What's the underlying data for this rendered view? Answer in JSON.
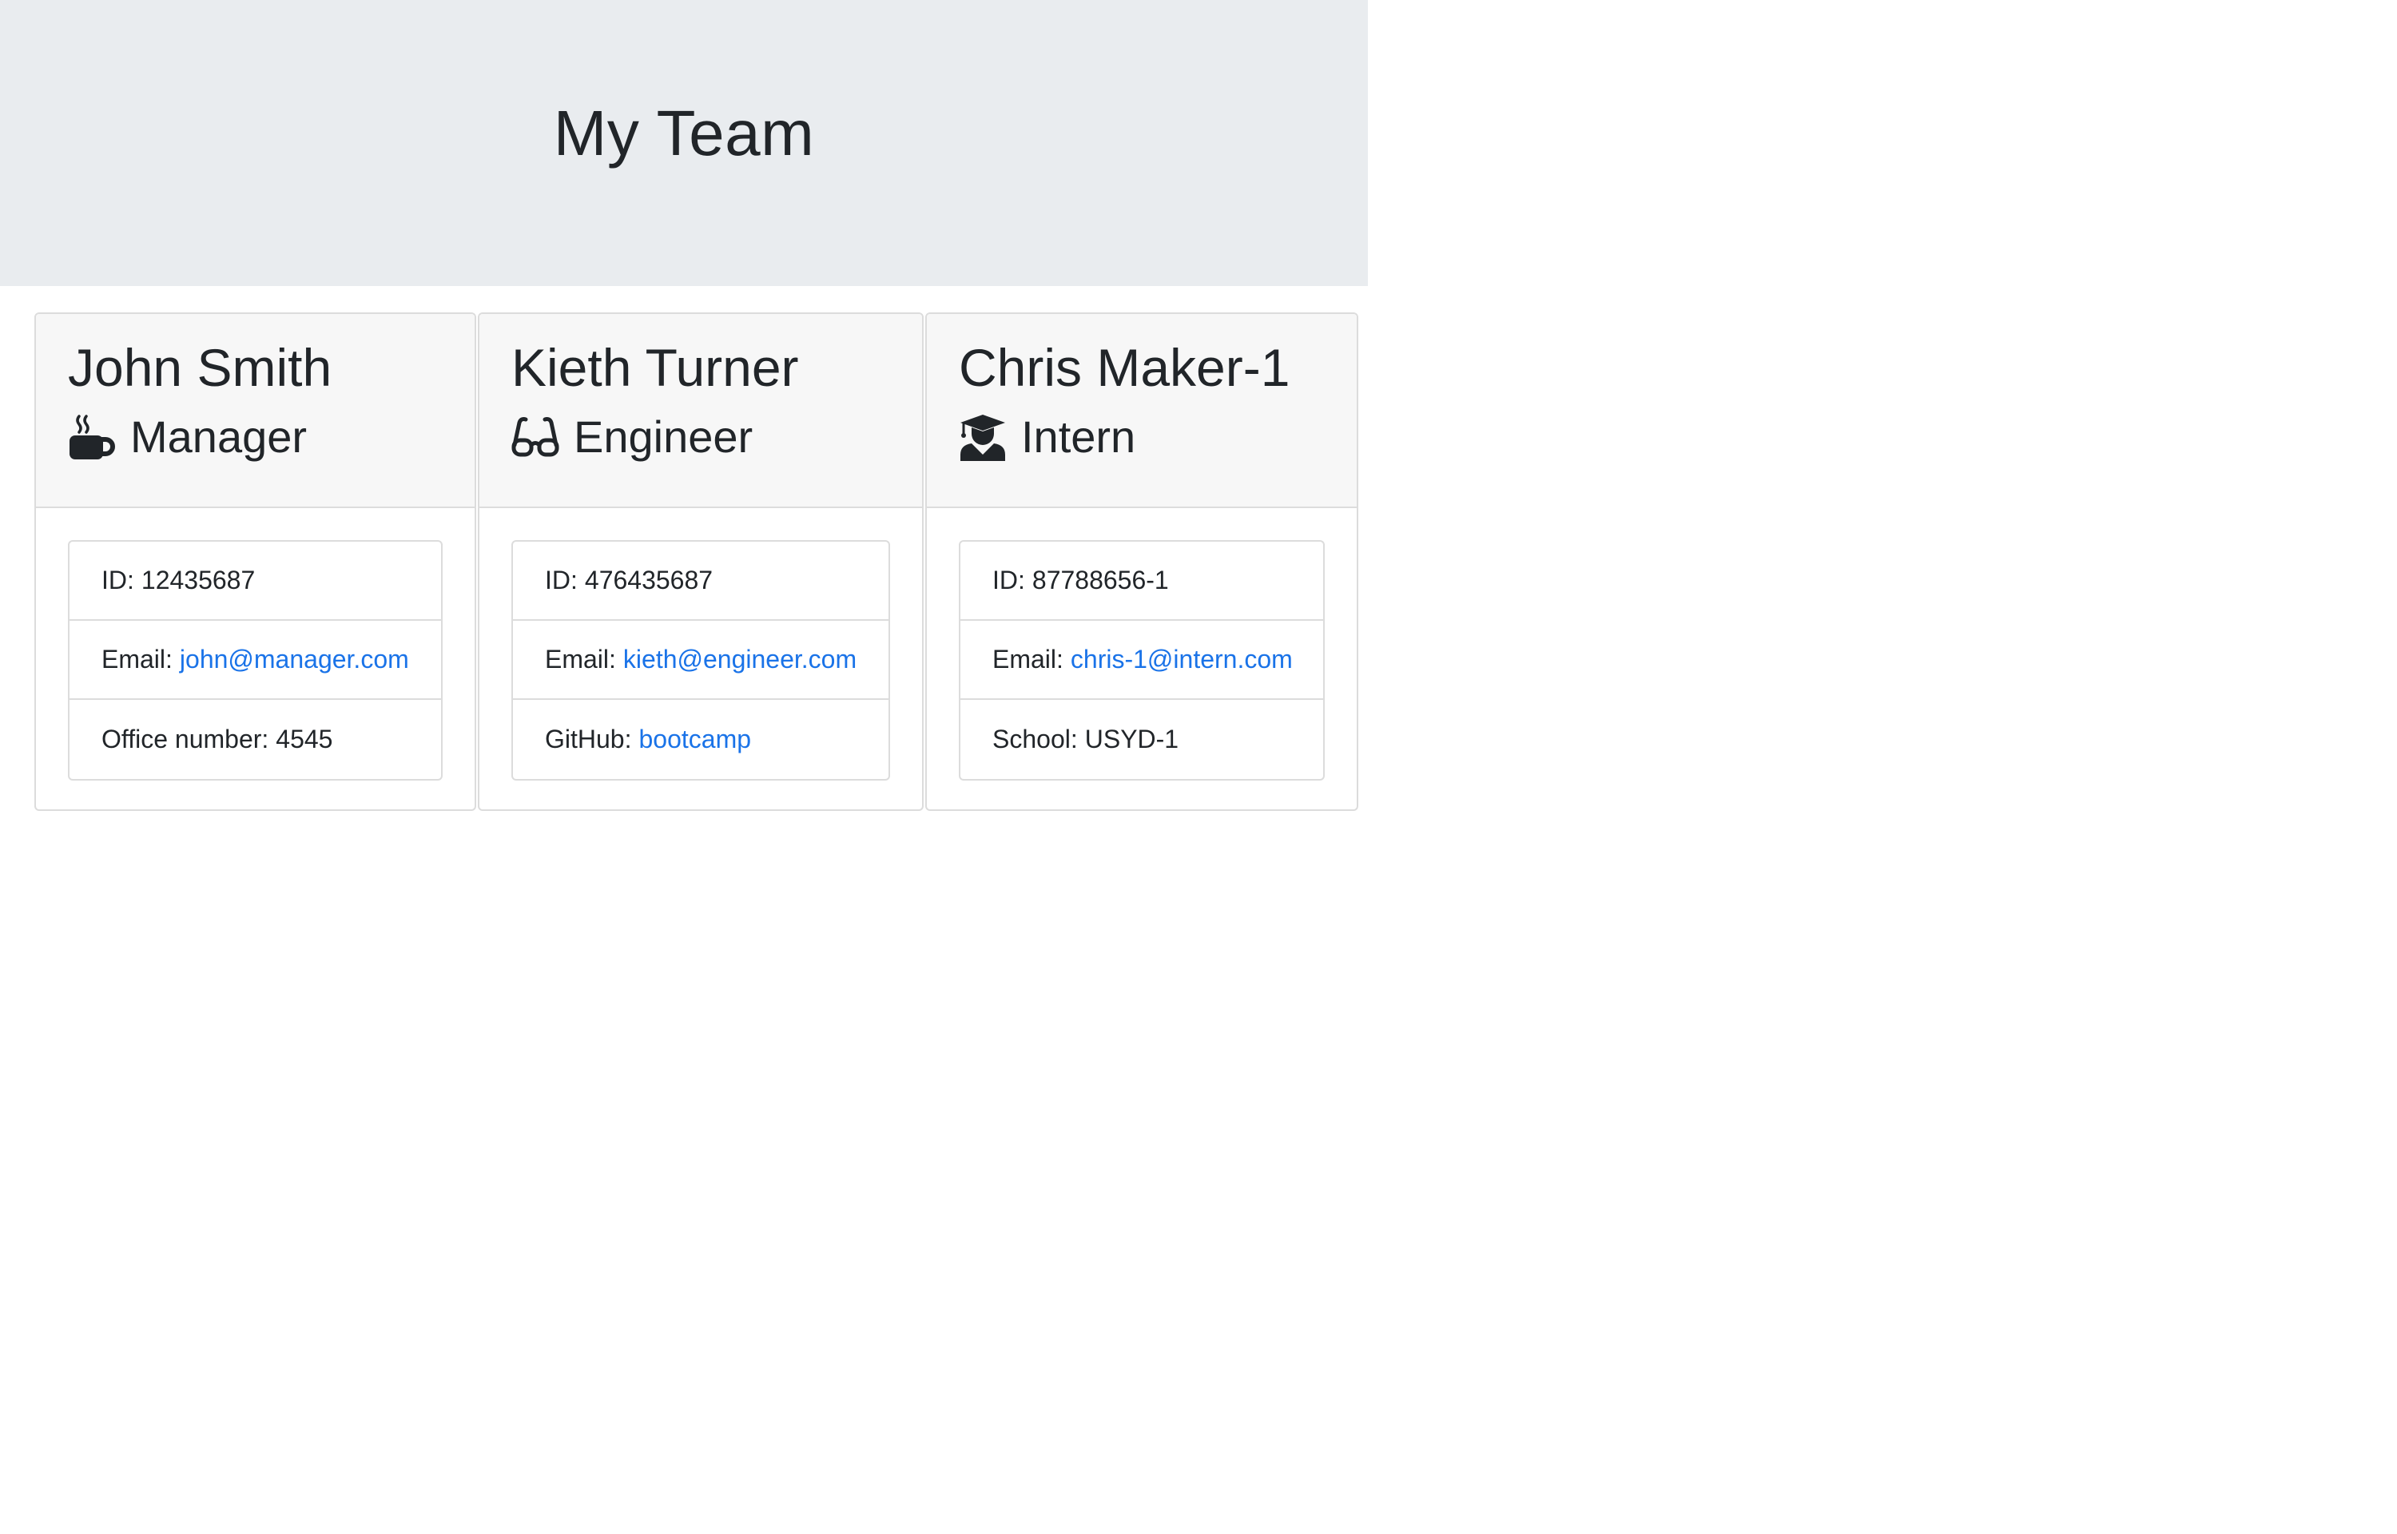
{
  "header": {
    "title": "My Team"
  },
  "members": [
    {
      "name": "John Smith",
      "role": "Manager",
      "icon": "mug-hot-icon",
      "id_label": "ID:",
      "id": "12435687",
      "email_label": "Email:",
      "email": "john@manager.com",
      "extra_label": "Office number:",
      "extra_value": "4545"
    },
    {
      "name": "Kieth Turner",
      "role": "Engineer",
      "icon": "glasses-icon",
      "id_label": "ID:",
      "id": "476435687",
      "email_label": "Email:",
      "email": "kieth@engineer.com",
      "extra_label": "GitHub:",
      "extra_value": "bootcamp"
    },
    {
      "name": "Chris Maker-1",
      "role": "Intern",
      "icon": "user-graduate-icon",
      "id_label": "ID:",
      "id": "87788656-1",
      "email_label": "Email:",
      "email": "chris-1@intern.com",
      "extra_label": "School:",
      "extra_value": "USYD-1"
    }
  ],
  "colors": {
    "link": "#1a73e8",
    "jumbotron_bg": "#e9ecef",
    "card_header_bg": "#f7f7f7",
    "text": "#212529"
  }
}
